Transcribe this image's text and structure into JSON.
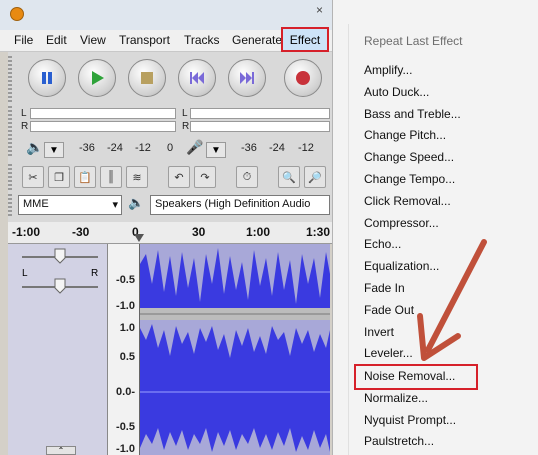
{
  "window": {
    "close_glyph": "×"
  },
  "menubar": {
    "items": [
      "File",
      "Edit",
      "View",
      "Transport",
      "Tracks",
      "Generate",
      "Effect"
    ]
  },
  "meter": {
    "left_channel": "L",
    "right_channel": "R",
    "ticks": [
      "-36",
      "-24",
      "-12",
      "0",
      "-36",
      "-24",
      "-12"
    ]
  },
  "device": {
    "host": "MME",
    "output": "Speakers (High Definition Audio"
  },
  "ruler": {
    "labels": [
      "-1:00",
      "-30",
      "0",
      "30",
      "1:00",
      "1:30"
    ]
  },
  "track": {
    "pan_left": "L",
    "pan_right": "R"
  },
  "vscale": {
    "labels": [
      "-0.5",
      "-1.0",
      "1.0",
      "0.5",
      "0.0-",
      "-0.5",
      "-1.0"
    ]
  },
  "effect_menu": {
    "repeat_label": "Repeat Last Effect",
    "items": [
      "Amplify...",
      "Auto Duck...",
      "Bass and Treble...",
      "Change Pitch...",
      "Change Speed...",
      "Change Tempo...",
      "Click Removal...",
      "Compressor...",
      "Echo...",
      "Equalization...",
      "Fade In",
      "Fade Out",
      "Invert",
      "Leveler...",
      "Noise Removal...",
      "Normalize...",
      "Nyquist Prompt...",
      "Paulstretch..."
    ]
  },
  "colors": {
    "highlight_red": "#d6202a",
    "waveform_blue": "#3a3ae0",
    "waveform_bg": "#a8a8d8",
    "arrow": "#c0503a"
  }
}
